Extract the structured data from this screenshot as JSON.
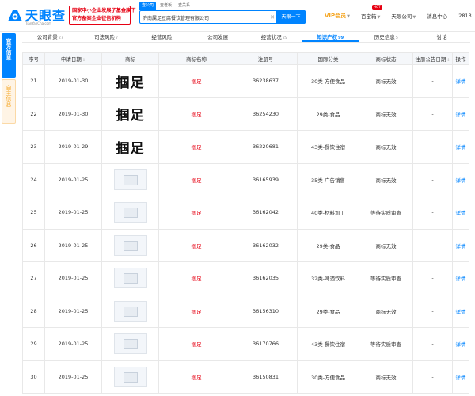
{
  "header": {
    "logo_text": "天眼查",
    "logo_url": "TianYanCha.com",
    "banner_line1": "国家中小企业发展子基金旗下",
    "banner_line2": "官方备案企业征信机构",
    "search_tabs": [
      "查公司",
      "查老板",
      "查关系"
    ],
    "search_value": "济南属足豆腐餐饮管理有限公司",
    "search_button": "天眼一下",
    "nav": {
      "vip": "VIP会员",
      "baibao": "百宝箱",
      "hot_badge": "HOT",
      "company": "天眼公司",
      "messages": "消息中心",
      "user": "2813..."
    }
  },
  "rail": {
    "official": "官方信息",
    "self": "自主信息"
  },
  "tabs": [
    {
      "label": "公司背景",
      "count": "27"
    },
    {
      "label": "司法风险",
      "count": "7"
    },
    {
      "label": "经营风险",
      "count": ""
    },
    {
      "label": "公司发展",
      "count": ""
    },
    {
      "label": "经营状况",
      "count": "29"
    },
    {
      "label": "知识产权",
      "count": "99"
    },
    {
      "label": "历史信息",
      "count": "5"
    },
    {
      "label": "讨论",
      "count": ""
    }
  ],
  "table": {
    "headers": [
      "序号",
      "申请日期",
      "商标",
      "商标名称",
      "注册号",
      "国际分类",
      "商标状态",
      "注册公告日期",
      "操作"
    ],
    "rows": [
      {
        "no": "21",
        "date": "2019-01-30",
        "mark_text": "掴足",
        "name": "掴足",
        "reg": "36238637",
        "class": "30类-方便食品",
        "status": "商标无效",
        "pub": "-",
        "op": "详情"
      },
      {
        "no": "22",
        "date": "2019-01-30",
        "mark_text": "掴足",
        "name": "掴足",
        "reg": "36254230",
        "class": "29类-食品",
        "status": "商标无效",
        "pub": "-",
        "op": "详情"
      },
      {
        "no": "23",
        "date": "2019-01-29",
        "mark_text": "掴足",
        "name": "掴足",
        "reg": "36220681",
        "class": "43类-餐饮住宿",
        "status": "商标无效",
        "pub": "-",
        "op": "详情"
      },
      {
        "no": "24",
        "date": "2019-01-25",
        "mark_text": "",
        "name": "掴足",
        "reg": "36165939",
        "class": "35类-广告销售",
        "status": "商标无效",
        "pub": "-",
        "op": "详情"
      },
      {
        "no": "25",
        "date": "2019-01-25",
        "mark_text": "",
        "name": "掴足",
        "reg": "36162042",
        "class": "40类-材料加工",
        "status": "等待实质审查",
        "pub": "-",
        "op": "详情"
      },
      {
        "no": "26",
        "date": "2019-01-25",
        "mark_text": "",
        "name": "掴足",
        "reg": "36162032",
        "class": "29类-食品",
        "status": "商标无效",
        "pub": "-",
        "op": "详情"
      },
      {
        "no": "27",
        "date": "2019-01-25",
        "mark_text": "",
        "name": "掴足",
        "reg": "36162035",
        "class": "32类-啤酒饮料",
        "status": "等待实质审查",
        "pub": "-",
        "op": "详情"
      },
      {
        "no": "28",
        "date": "2019-01-25",
        "mark_text": "",
        "name": "掴足",
        "reg": "36156310",
        "class": "29类-食品",
        "status": "商标无效",
        "pub": "-",
        "op": "详情"
      },
      {
        "no": "29",
        "date": "2019-01-25",
        "mark_text": "",
        "name": "掴足",
        "reg": "36170766",
        "class": "43类-餐饮住宿",
        "status": "等待实质审查",
        "pub": "-",
        "op": "详情"
      },
      {
        "no": "30",
        "date": "2019-01-25",
        "mark_text": "",
        "name": "掴足",
        "reg": "36150831",
        "class": "30类-方便食品",
        "status": "商标无效",
        "pub": "-",
        "op": "详情"
      }
    ]
  },
  "colors": {
    "brand": "#0084ff",
    "accent_red": "#e60012",
    "vip": "#f5a623"
  }
}
